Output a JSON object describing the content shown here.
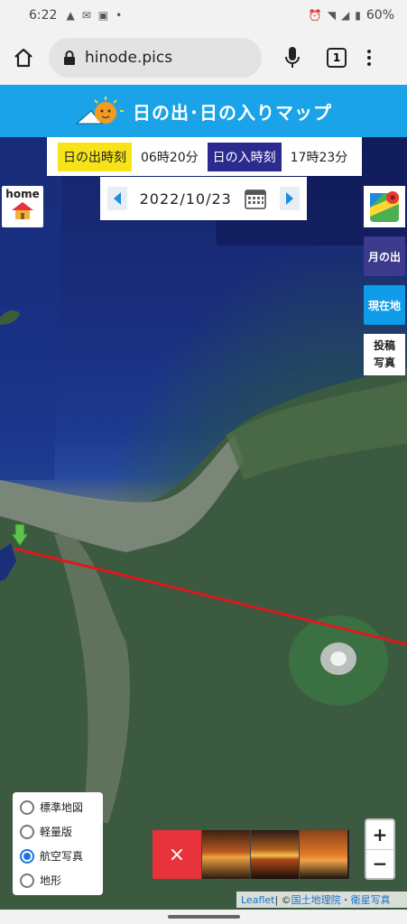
{
  "status_bar": {
    "time": "6:22",
    "battery": "60%"
  },
  "browser": {
    "url": "hinode.pics",
    "tab_count": "1"
  },
  "banner": {
    "title": "日の出･日の入りマップ"
  },
  "times": {
    "sunrise_label": "日の出時刻",
    "sunrise_value": "06時20分",
    "sunset_label": "日の入時刻",
    "sunset_value": "17時23分"
  },
  "date": {
    "value": "2022/10/23"
  },
  "home": {
    "label": "home"
  },
  "side_buttons": {
    "moonrise": "月の出",
    "current_location": "現在地",
    "post_line1": "投稿",
    "post_line2": "写真"
  },
  "layers": [
    {
      "label": "標準地図",
      "selected": false
    },
    {
      "label": "軽量版",
      "selected": false
    },
    {
      "label": "航空写真",
      "selected": true
    },
    {
      "label": "地形",
      "selected": false
    }
  ],
  "photo_strip": {
    "close": "×"
  },
  "zoom": {
    "in": "+",
    "out": "−"
  },
  "attribution": {
    "leaflet": "Leaflet",
    "sep": " | © ",
    "source": "国土地理院・衛星写真"
  },
  "colors": {
    "sun_line": "#e0181e",
    "banner": "#1aa3e8",
    "sunset_badge": "#2b2a8e",
    "sunrise_badge": "#f7e319"
  }
}
